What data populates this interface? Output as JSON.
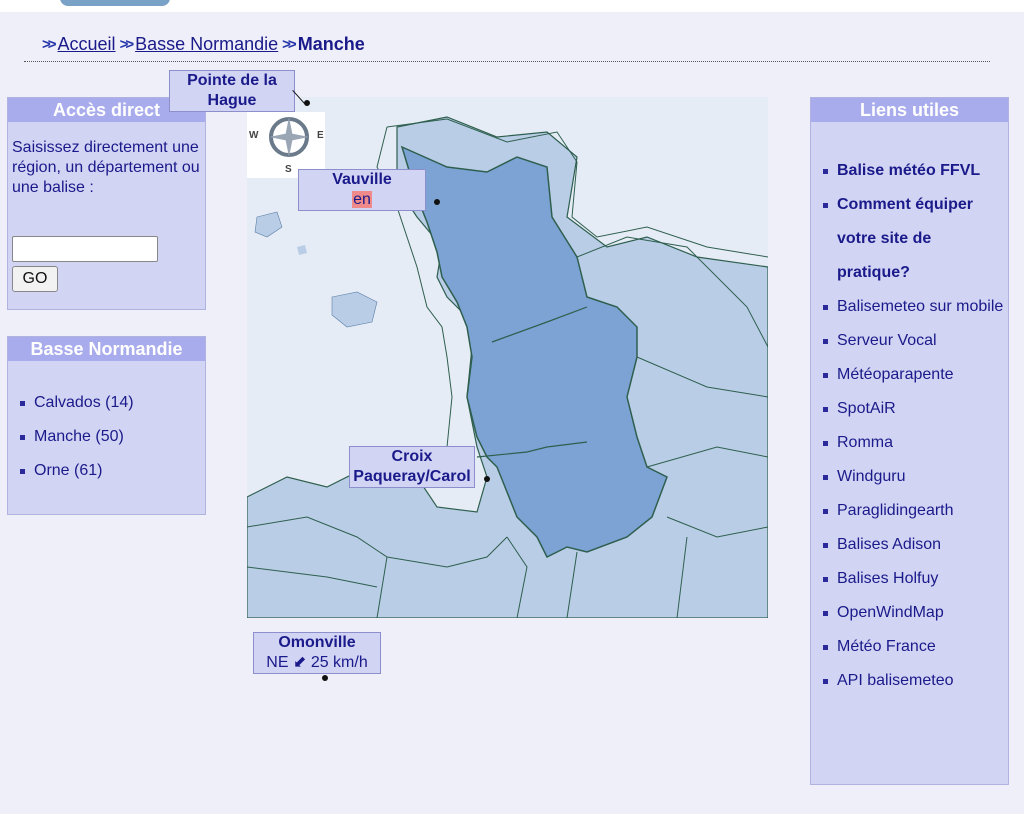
{
  "breadcrumb": {
    "home": "Accueil",
    "region": "Basse Normandie",
    "current": "Manche",
    "separator": "»"
  },
  "acces_direct": {
    "title": "Accès direct",
    "description": "Saisissez directement une région, un département ou une balise :",
    "input_value": "",
    "go_label": "GO"
  },
  "region_panel": {
    "title": "Basse Normandie",
    "items": [
      {
        "label": "Calvados (14)"
      },
      {
        "label": "Manche (50)"
      },
      {
        "label": "Orne (61)"
      }
    ]
  },
  "liens": {
    "title": "Liens utiles",
    "items": [
      {
        "label": "Balise météo FFVL",
        "bold": true
      },
      {
        "label": "Comment équiper votre site de pratique?",
        "bold": true
      },
      {
        "label": "Balisemeteo sur mobile",
        "bold": false
      },
      {
        "label": "Serveur Vocal",
        "bold": false
      },
      {
        "label": "Météoparapente",
        "bold": false
      },
      {
        "label": "SpotAiR",
        "bold": false
      },
      {
        "label": "Romma",
        "bold": false
      },
      {
        "label": "Windguru",
        "bold": false
      },
      {
        "label": "Paraglidingearth",
        "bold": false
      },
      {
        "label": "Balises Adison",
        "bold": false
      },
      {
        "label": "Balises Holfuy",
        "bold": false
      },
      {
        "label": "OpenWindMap",
        "bold": false
      },
      {
        "label": "Météo France",
        "bold": false
      },
      {
        "label": "API balisemeteo",
        "bold": false
      }
    ]
  },
  "compass": {
    "n": "",
    "w": "W",
    "e": "E",
    "s": "S"
  },
  "stations": {
    "hague": {
      "name": "Pointe de la Hague"
    },
    "vauville": {
      "name": "Vauville",
      "direction": "en"
    },
    "croix": {
      "name": "Croix Paqueray/Carol"
    },
    "omonville": {
      "name": "Omonville",
      "direction": "NE",
      "arrow": "⬋",
      "speed": "25 km/h"
    }
  },
  "colors": {
    "background": "#eeeff8",
    "panel": "#d2d4f4",
    "panel_header": "#a9acec",
    "link": "#1a1a8a",
    "manche_fill": "#7da3d4",
    "sea": "#e6ecf6",
    "land": "#b9cde6",
    "direction_highlight": "#f08a8a"
  }
}
